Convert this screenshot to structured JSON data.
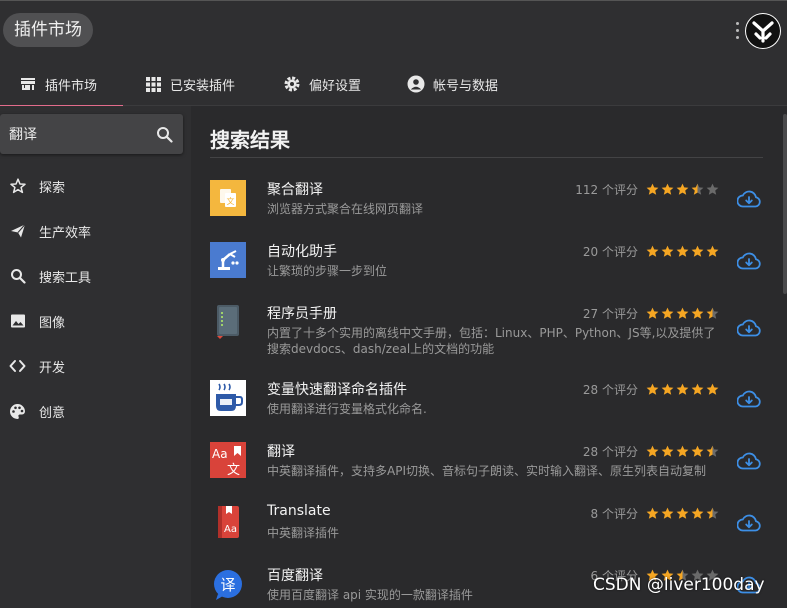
{
  "app": {
    "title": "插件市场"
  },
  "tabs": [
    {
      "label": "插件市场",
      "icon": "store-icon",
      "active": true
    },
    {
      "label": "已安装插件",
      "icon": "grid-icon",
      "active": false
    },
    {
      "label": "偏好设置",
      "icon": "gear-icon",
      "active": false
    },
    {
      "label": "帐号与数据",
      "icon": "account-icon",
      "active": false
    }
  ],
  "search": {
    "value": "翻译",
    "placeholder": ""
  },
  "sidebar": {
    "items": [
      {
        "label": "探索",
        "icon": "star-outline-icon"
      },
      {
        "label": "生产效率",
        "icon": "send-icon"
      },
      {
        "label": "搜索工具",
        "icon": "search-icon"
      },
      {
        "label": "图像",
        "icon": "image-icon"
      },
      {
        "label": "开发",
        "icon": "code-icon"
      },
      {
        "label": "创意",
        "icon": "palette-icon"
      }
    ]
  },
  "main": {
    "section_title": "搜索结果",
    "plugins": [
      {
        "name": "聚合翻译",
        "desc": "浏览器方式聚合在线网页翻译",
        "ratings": "112 个评分",
        "stars": 3.5,
        "icon": "aggregate-translate-icon"
      },
      {
        "name": "自动化助手",
        "desc": "让繁琐的步骤一步到位",
        "ratings": "20 个评分",
        "stars": 5,
        "icon": "robot-arm-icon"
      },
      {
        "name": "程序员手册",
        "desc": "内置了十多个实用的离线中文手册，包括：Linux、PHP、Python、JS等,以及提供了搜索devdocs、dash/zeal上的文档的功能",
        "ratings": "27 个评分",
        "stars": 4.5,
        "icon": "book-icon"
      },
      {
        "name": "变量快速翻译命名插件",
        "desc": "使用翻译进行变量格式化命名.",
        "ratings": "28 个评分",
        "stars": 5,
        "icon": "coffee-cup-icon"
      },
      {
        "name": "翻译",
        "desc": "中英翻译插件，支持多API切换、音标句子朗读、实时输入翻译、原生列表自动复制",
        "ratings": "28 个评分",
        "stars": 4.5,
        "icon": "aa-wen-icon"
      },
      {
        "name": "Translate",
        "desc": "中英翻译插件",
        "ratings": "8 个评分",
        "stars": 4.5,
        "icon": "red-dictionary-icon"
      },
      {
        "name": "百度翻译",
        "desc": "使用百度翻译 api 实现的一款翻译插件",
        "ratings": "6 个评分",
        "stars": 2.5,
        "icon": "baidu-translate-icon"
      }
    ]
  },
  "colors": {
    "accent": "#e36c8c",
    "star": "#f5a623",
    "star_empty": "#6a6a6a",
    "download": "#3d8fe6"
  },
  "watermark": "CSDN @liver100day"
}
